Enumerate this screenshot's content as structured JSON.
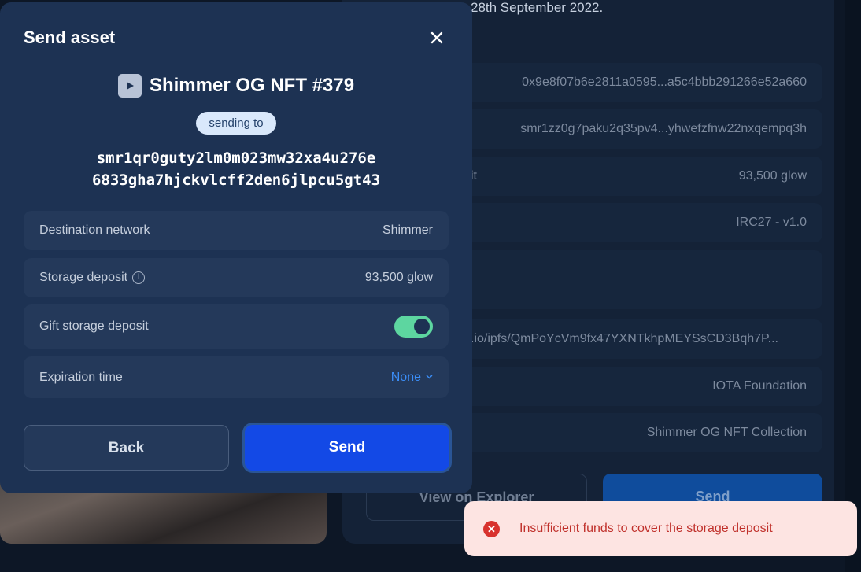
{
  "background": {
    "date_text": "28th September 2022.",
    "rows": [
      {
        "label": "",
        "value": "0x9e8f07b6e2811a0595...a5c4bbb291266e52a660"
      },
      {
        "label": "",
        "value": "smr1zz0g7paku2q35pv4...yhwefzfnw22nxqempq3h"
      },
      {
        "label": "it",
        "value": "93,500 glow"
      },
      {
        "label": "",
        "value": "IRC27 - v1.0"
      },
      {
        "label": "",
        "value": ""
      },
      {
        "label": "",
        "value": "s.io/ipfs/QmPoYcVm9fx47YXNTkhpMEYSsCD3Bqh7P..."
      },
      {
        "label": "",
        "value": "IOTA Foundation"
      },
      {
        "label": "",
        "value": "Shimmer OG NFT Collection"
      }
    ],
    "explorer_button": "View on Explorer",
    "send_button": "Send"
  },
  "modal": {
    "title": "Send asset",
    "close_icon": "close-icon",
    "asset_icon": "play-icon",
    "asset_name": "Shimmer OG NFT #379",
    "sending_to_label": "sending to",
    "address_line1": "smr1qr0guty2lm0m023mw32xa4u276e",
    "address_line2": "6833gha7hjckvlcff2den6jlpcu5gt43",
    "details": {
      "destination_network": {
        "label": "Destination network",
        "value": "Shimmer"
      },
      "storage_deposit": {
        "label": "Storage deposit",
        "value": "93,500 glow"
      },
      "gift_storage_deposit": {
        "label": "Gift storage deposit",
        "enabled": true
      },
      "expiration_time": {
        "label": "Expiration time",
        "value": "None"
      }
    },
    "back_button": "Back",
    "send_button": "Send"
  },
  "toast": {
    "type": "error",
    "message": "Insufficient funds to cover the storage deposit"
  },
  "colors": {
    "accent": "#1349e6",
    "toggle_on": "#5dd6a0",
    "link": "#3b8df6",
    "error": "#d8322e"
  }
}
